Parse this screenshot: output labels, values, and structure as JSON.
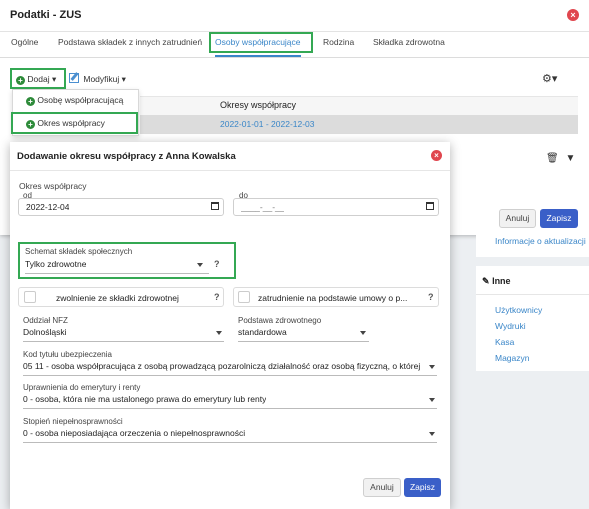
{
  "window": {
    "title": "Podatki - ZUS"
  },
  "tabs": [
    {
      "label": "Ogólne"
    },
    {
      "label": "Podstawa składek z innych zatrudnień"
    },
    {
      "label": "Osoby współpracujące"
    },
    {
      "label": "Rodzina"
    },
    {
      "label": "Składka zdrowotna"
    }
  ],
  "toolbar": {
    "add_label": "Dodaj",
    "modify_label": "Modyfikuj"
  },
  "add_menu": {
    "items": [
      {
        "label": "Osobę współpracującą"
      },
      {
        "label": "Okres współpracy"
      }
    ]
  },
  "table": {
    "header": "Okresy współpracy",
    "row": "2022-01-01 - 2022-12-03"
  },
  "bg_footer": {
    "cancel": "Anuluj",
    "save": "Zapisz"
  },
  "side": {
    "info_link": "Informacje o aktualizacji",
    "inne": {
      "title": "Inne",
      "links": [
        "Użytkownicy",
        "Wydruki",
        "Kasa",
        "Magazyn"
      ]
    }
  },
  "dialog": {
    "title": "Dodawanie okresu współpracy z Anna Kowalska",
    "period_label": "Okres współpracy",
    "from_label": "od",
    "from_value": "2022-12-04",
    "to_label": "do",
    "to_placeholder": "____-__-__",
    "schemat_label": "Schemat składek społecznych",
    "schemat_value": "Tylko zdrowotne",
    "zwolnienie": "zwolnienie ze składki zdrowotnej",
    "zatrudnienie": "zatrudnienie na podstawie umowy o p...",
    "nfz_label": "Oddział NFZ",
    "nfz_value": "Dolnośląski",
    "podstawa_label": "Podstawa zdrowotnego",
    "podstawa_value": "standardowa",
    "kod_label": "Kod tytułu ubezpieczenia",
    "kod_value": "05 11 - osoba współpracująca z osobą prowadzącą pozarolniczą działalność oraz osobą fizyczną, o której m",
    "emeryt_label": "Uprawnienia do emerytury i renty",
    "emeryt_value": "0 - osoba, która nie ma ustalonego prawa do emerytury lub renty",
    "niepeln_label": "Stopień niepełnosprawności",
    "niepeln_value": "0 - osoba nieposiadająca orzeczenia o niepełnosprawności",
    "cancel": "Anuluj",
    "save": "Zapisz"
  },
  "colors": {
    "accent": "#3a86c8",
    "primary_button": "#3a5fc8",
    "highlight": "#34a853",
    "close": "#e0464e"
  }
}
